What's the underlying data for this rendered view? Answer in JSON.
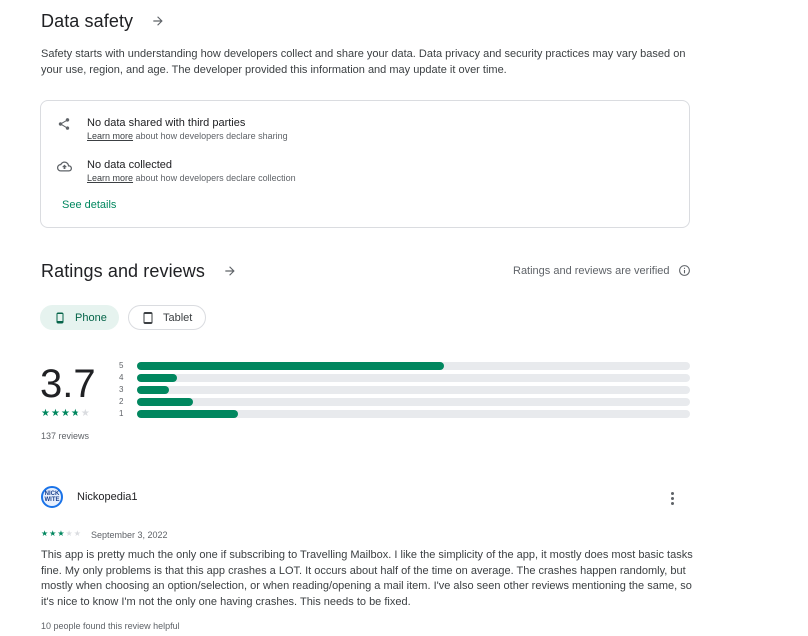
{
  "data_safety": {
    "title": "Data safety",
    "description": "Safety starts with understanding how developers collect and share your data. Data privacy and security practices may vary based on your use, region, and age. The developer provided this information and may update it over time.",
    "items": [
      {
        "icon": "share-icon",
        "title": "No data shared with third parties",
        "link": "Learn more",
        "suffix": " about how developers declare sharing"
      },
      {
        "icon": "cloud-upload-icon",
        "title": "No data collected",
        "link": "Learn more",
        "suffix": " about how developers declare collection"
      }
    ],
    "see_details": "See details"
  },
  "ratings": {
    "title": "Ratings and reviews",
    "verified": "Ratings and reviews are verified",
    "chips": [
      {
        "label": "Phone",
        "selected": true
      },
      {
        "label": "Tablet",
        "selected": false
      }
    ],
    "score": "3.7",
    "star_value": 3.7,
    "count": "137 reviews",
    "distribution": [
      {
        "label": "5",
        "fraction": 0.555
      },
      {
        "label": "4",
        "fraction": 0.072
      },
      {
        "label": "3",
        "fraction": 0.058
      },
      {
        "label": "2",
        "fraction": 0.101
      },
      {
        "label": "1",
        "fraction": 0.182
      }
    ]
  },
  "review": {
    "avatar_text": "NICK WITE",
    "name": "Nickopedia1",
    "stars": 3,
    "date": "September 3, 2022",
    "text": "This app is pretty much the only one if subscribing to Travelling Mailbox. I like the simplicity of the app, it mostly does most basic tasks fine. My only problems is that this app crashes a LOT. It occurs about half of the time on average. The crashes happen randomly, but mostly when choosing an option/selection, or when reading/opening a mail item. I've also seen other reviews mentioning the same, so it's nice to know I'm not the only one having crashes. This needs to be fixed.",
    "helpful": "10 people found this review helpful"
  },
  "colors": {
    "accent": "#01875f",
    "star": "#01875f",
    "star_empty": "#dadce0",
    "chip_selected_bg": "#e6f3ef"
  }
}
